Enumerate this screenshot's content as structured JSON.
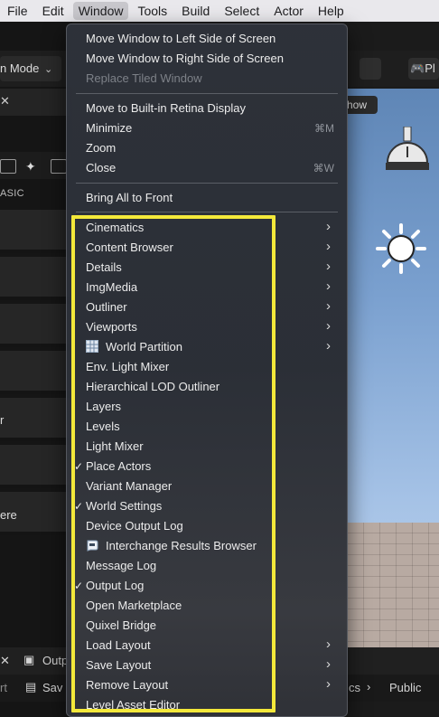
{
  "menubar": {
    "items": [
      {
        "label": "File"
      },
      {
        "label": "Edit"
      },
      {
        "label": "Window"
      },
      {
        "label": "Tools"
      },
      {
        "label": "Build"
      },
      {
        "label": "Select"
      },
      {
        "label": "Actor"
      },
      {
        "label": "Help"
      }
    ],
    "active": "Window"
  },
  "background": {
    "mode_label": "n Mode",
    "basic_label": "ASIC",
    "row_text_1": "r",
    "row_text_2": "ere",
    "viewport_show": "how",
    "top_right_label": "Pl",
    "bottom_tab_label": "Outp",
    "bottom_left_label": "rt",
    "bottom_save_label": "Sav",
    "breadcrumb_1": "cs",
    "breadcrumb_2": "Public"
  },
  "window_menu": {
    "group1": {
      "move_left": "Move Window to Left Side of Screen",
      "move_right": "Move Window to Right Side of Screen",
      "replace_tiled": "Replace Tiled Window"
    },
    "group2": {
      "move_retina": "Move to Built-in Retina Display",
      "minimize": "Minimize",
      "minimize_shortcut": "⌘M",
      "zoom": "Zoom",
      "close": "Close",
      "close_shortcut": "⌘W"
    },
    "group3": {
      "bring_all": "Bring All to Front"
    },
    "items": [
      {
        "label": "Cinematics",
        "submenu": true,
        "checked": false
      },
      {
        "label": "Content Browser",
        "submenu": true,
        "checked": false
      },
      {
        "label": "Details",
        "submenu": true,
        "checked": false
      },
      {
        "label": "ImgMedia",
        "submenu": true,
        "checked": false
      },
      {
        "label": "Outliner",
        "submenu": true,
        "checked": false
      },
      {
        "label": "Viewports",
        "submenu": true,
        "checked": false
      },
      {
        "label": "World Partition",
        "submenu": true,
        "checked": false,
        "icon": "world-partition-icon"
      },
      {
        "label": "Env. Light Mixer",
        "submenu": false,
        "checked": false
      },
      {
        "label": "Hierarchical LOD Outliner",
        "submenu": false,
        "checked": false
      },
      {
        "label": "Layers",
        "submenu": false,
        "checked": false
      },
      {
        "label": "Levels",
        "submenu": false,
        "checked": false
      },
      {
        "label": "Light Mixer",
        "submenu": false,
        "checked": false
      },
      {
        "label": "Place Actors",
        "submenu": false,
        "checked": true
      },
      {
        "label": "Variant Manager",
        "submenu": false,
        "checked": false
      },
      {
        "label": "World Settings",
        "submenu": false,
        "checked": true
      },
      {
        "label": "Device Output Log",
        "submenu": false,
        "checked": false
      },
      {
        "label": "Interchange Results Browser",
        "submenu": false,
        "checked": false,
        "icon": "interchange-icon"
      },
      {
        "label": "Message Log",
        "submenu": false,
        "checked": false
      },
      {
        "label": "Output Log",
        "submenu": false,
        "checked": true
      },
      {
        "label": "Open Marketplace",
        "submenu": false,
        "checked": false
      },
      {
        "label": "Quixel Bridge",
        "submenu": false,
        "checked": false
      },
      {
        "label": "Load Layout",
        "submenu": true,
        "checked": false
      },
      {
        "label": "Save Layout",
        "submenu": true,
        "checked": false
      },
      {
        "label": "Remove Layout",
        "submenu": true,
        "checked": false
      },
      {
        "label": "Level Asset Editor",
        "submenu": false,
        "checked": false
      }
    ]
  },
  "colors": {
    "highlight": "#f3e83a",
    "menubar_bg": "#e9e8ec"
  }
}
